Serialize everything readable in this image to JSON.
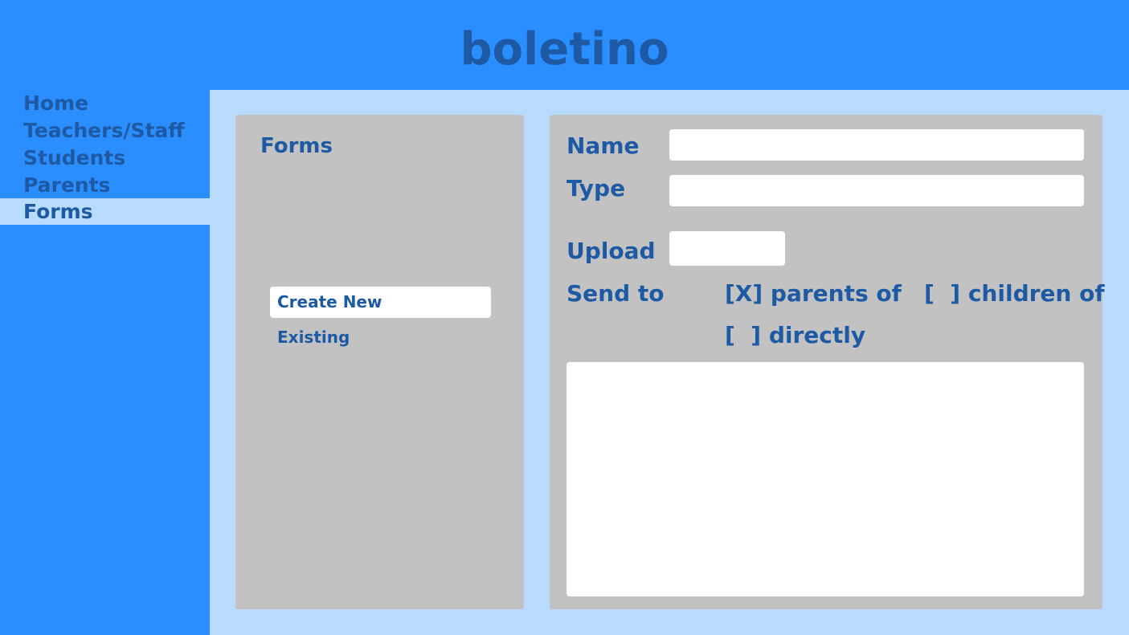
{
  "app": {
    "title": "boletino"
  },
  "sidebar": {
    "items": [
      {
        "label": "Home",
        "active": false
      },
      {
        "label": "Teachers/Staff",
        "active": false
      },
      {
        "label": "Students",
        "active": false
      },
      {
        "label": "Parents",
        "active": false
      },
      {
        "label": "Forms",
        "active": true
      }
    ]
  },
  "forms_panel": {
    "title": "Forms",
    "options": [
      {
        "label": "Create New",
        "selected": true
      },
      {
        "label": "Existing",
        "selected": false
      }
    ]
  },
  "form_editor": {
    "name_label": "Name",
    "name_value": "",
    "type_label": "Type",
    "type_value": "",
    "upload_label": "Upload",
    "upload_value": "",
    "send_to_label": "Send to",
    "send_options": [
      {
        "label": "[X] parents of",
        "checked": true
      },
      {
        "label": "[  ] children of",
        "checked": false
      },
      {
        "label": "[  ] directly",
        "checked": false
      }
    ],
    "message_value": ""
  },
  "colors": {
    "header_bg": "#2b8eff",
    "text": "#1e5aa4",
    "content_bg": "#b8dbff",
    "panel_bg": "#c2c2c2",
    "input_bg": "#ffffff"
  }
}
